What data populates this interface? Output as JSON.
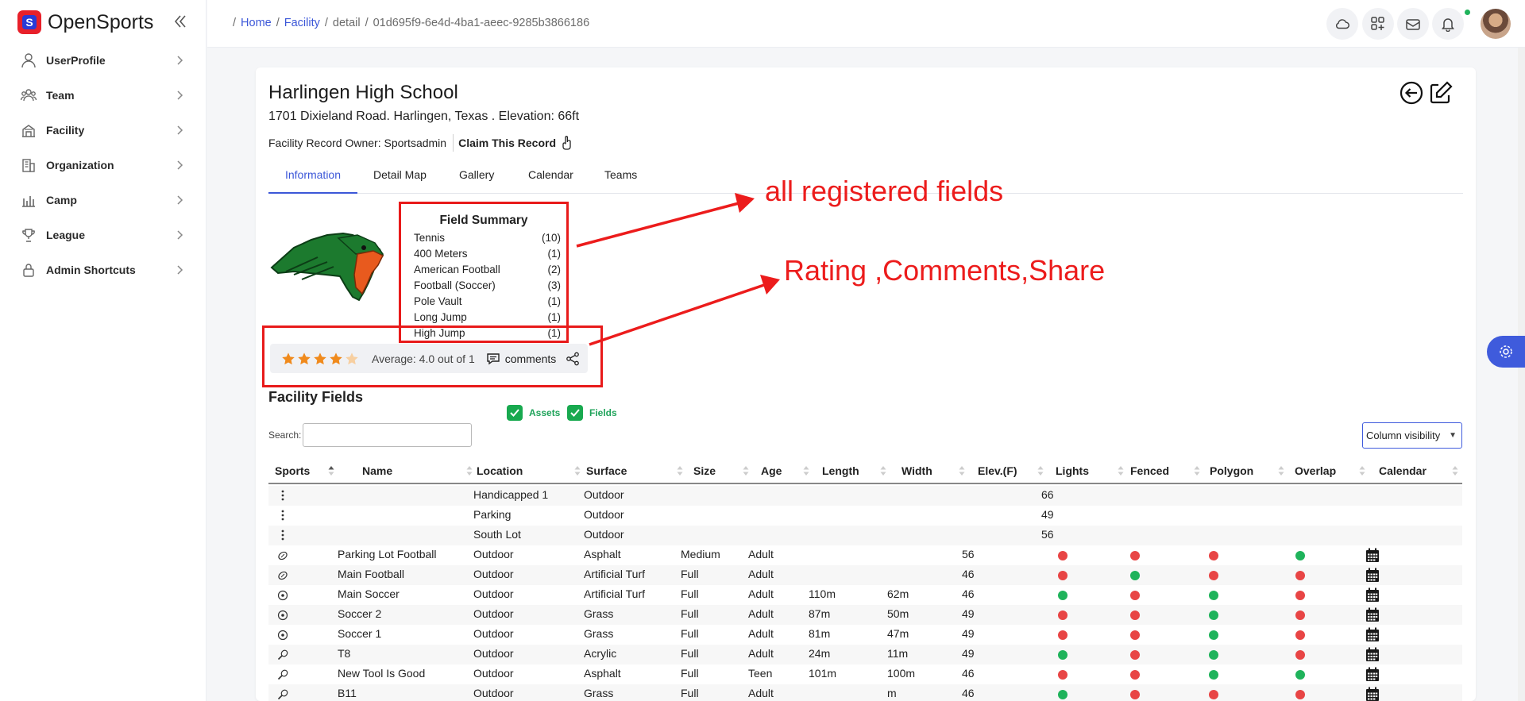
{
  "app": {
    "name": "OpenSports",
    "logo_letter": "S"
  },
  "sidebar": {
    "items": [
      {
        "label": "UserProfile",
        "icon": "user-icon"
      },
      {
        "label": "Team",
        "icon": "team-icon"
      },
      {
        "label": "Facility",
        "icon": "facility-icon"
      },
      {
        "label": "Organization",
        "icon": "organization-icon"
      },
      {
        "label": "Camp",
        "icon": "camp-icon"
      },
      {
        "label": "League",
        "icon": "trophy-icon"
      },
      {
        "label": "Admin Shortcuts",
        "icon": "lock-icon"
      }
    ]
  },
  "breadcrumb": {
    "home": "Home",
    "facility": "Facility",
    "detail": "detail",
    "id": "01d695f9-6e4d-4ba1-aeec-9285b3866186"
  },
  "facility": {
    "name": "Harlingen High School",
    "address": "1701 Dixieland Road. Harlingen, Texas . Elevation: 66ft",
    "owner": "Facility Record Owner: Sportsadmin",
    "claim": "Claim This Record"
  },
  "tabs": [
    "Information",
    "Detail Map",
    "Gallery",
    "Calendar",
    "Teams"
  ],
  "summary": {
    "title": "Field Summary",
    "rows": [
      {
        "sport": "Tennis",
        "count": "(10)"
      },
      {
        "sport": "400 Meters",
        "count": "(1)"
      },
      {
        "sport": "American Football",
        "count": "(2)"
      },
      {
        "sport": "Football (Soccer)",
        "count": "(3)"
      },
      {
        "sport": "Pole Vault",
        "count": "(1)"
      },
      {
        "sport": "Long Jump",
        "count": "(1)"
      },
      {
        "sport": "High Jump",
        "count": "(1)"
      }
    ]
  },
  "rating": {
    "stars_filled": 4,
    "stars_total": 5,
    "average_text": "Average: 4.0 out of 1",
    "comments_label": "comments",
    "star_color": "#f08a1c"
  },
  "annotations": {
    "fields": "all registered fields",
    "rating": "Rating ,Comments,Share",
    "color": "#ec1c1c"
  },
  "fields_section": {
    "title": "Facility Fields",
    "assets_label": "Assets",
    "fields_label": "Fields",
    "search_label": "Search:",
    "column_visibility": "Column visibility"
  },
  "table": {
    "headers": [
      "Sports",
      "Name",
      "Location",
      "Surface",
      "Size",
      "Age",
      "Length",
      "Width",
      "Elev.(F)",
      "Lights",
      "Fenced",
      "Polygon",
      "Overlap",
      "Calendar"
    ],
    "asset_rows": [
      {
        "name": "Handicapped 1",
        "surface": "Outdoor",
        "elev": "66"
      },
      {
        "name": "Parking",
        "surface": "Outdoor",
        "elev": "49"
      },
      {
        "name": "South Lot",
        "surface": "Outdoor",
        "elev": "56"
      }
    ],
    "field_rows": [
      {
        "sport_icon": "football-icon",
        "name": "Parking Lot Football",
        "location": "Outdoor",
        "surface": "Asphalt",
        "size": "Medium",
        "age": "Adult",
        "length": "",
        "width": "",
        "elev": "56",
        "lights": "red",
        "fenced": "red",
        "polygon": "red",
        "overlap": "green"
      },
      {
        "sport_icon": "football-icon",
        "name": "Main Football",
        "location": "Outdoor",
        "surface": "Artificial Turf",
        "size": "Full",
        "age": "Adult",
        "length": "",
        "width": "",
        "elev": "46",
        "lights": "red",
        "fenced": "green",
        "polygon": "red",
        "overlap": "red"
      },
      {
        "sport_icon": "soccer-icon",
        "name": "Main Soccer",
        "location": "Outdoor",
        "surface": "Artificial Turf",
        "size": "Full",
        "age": "Adult",
        "length": "110m",
        "width": "62m",
        "elev": "46",
        "lights": "green",
        "fenced": "red",
        "polygon": "green",
        "overlap": "red"
      },
      {
        "sport_icon": "soccer-icon",
        "name": "Soccer 2",
        "location": "Outdoor",
        "surface": "Grass",
        "size": "Full",
        "age": "Adult",
        "length": "87m",
        "width": "50m",
        "elev": "49",
        "lights": "red",
        "fenced": "red",
        "polygon": "green",
        "overlap": "red"
      },
      {
        "sport_icon": "soccer-icon",
        "name": "Soccer 1",
        "location": "Outdoor",
        "surface": "Grass",
        "size": "Full",
        "age": "Adult",
        "length": "81m",
        "width": "47m",
        "elev": "49",
        "lights": "red",
        "fenced": "red",
        "polygon": "green",
        "overlap": "red"
      },
      {
        "sport_icon": "tennis-icon",
        "name": "T8",
        "location": "Outdoor",
        "surface": "Acrylic",
        "size": "Full",
        "age": "Adult",
        "length": "24m",
        "width": "11m",
        "elev": "49",
        "lights": "green",
        "fenced": "red",
        "polygon": "green",
        "overlap": "red"
      },
      {
        "sport_icon": "tennis-icon",
        "name": "New Tool Is Good",
        "location": "Outdoor",
        "surface": "Asphalt",
        "size": "Full",
        "age": "Teen",
        "length": "101m",
        "width": "100m",
        "elev": "46",
        "lights": "red",
        "fenced": "red",
        "polygon": "green",
        "overlap": "green"
      },
      {
        "sport_icon": "tennis-icon",
        "name": "B11",
        "location": "Outdoor",
        "surface": "Grass",
        "size": "Full",
        "age": "Adult",
        "length": "",
        "width": "m",
        "elev": "46",
        "lights": "green",
        "fenced": "red",
        "polygon": "red",
        "overlap": "red"
      }
    ]
  },
  "colors": {
    "accent": "#3c57d8",
    "red": "#e84545",
    "green": "#1fb35b",
    "brand_red": "#e8202a"
  }
}
